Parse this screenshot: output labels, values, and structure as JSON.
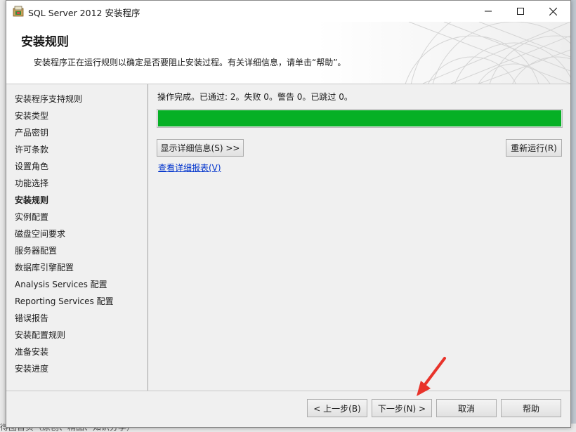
{
  "window": {
    "title": "SQL Server 2012 安装程序"
  },
  "header": {
    "title": "安装规则",
    "description": "安装程序正在运行规则以确定是否要阻止安装过程。有关详细信息，请单击“帮助”。"
  },
  "sidebar": {
    "items": [
      {
        "label": "安装程序支持规则",
        "active": false
      },
      {
        "label": "安装类型",
        "active": false
      },
      {
        "label": "产品密钥",
        "active": false
      },
      {
        "label": "许可条款",
        "active": false
      },
      {
        "label": "设置角色",
        "active": false
      },
      {
        "label": "功能选择",
        "active": false
      },
      {
        "label": "安装规则",
        "active": true
      },
      {
        "label": "实例配置",
        "active": false
      },
      {
        "label": "磁盘空间要求",
        "active": false
      },
      {
        "label": "服务器配置",
        "active": false
      },
      {
        "label": "数据库引擎配置",
        "active": false
      },
      {
        "label": "Analysis Services 配置",
        "active": false
      },
      {
        "label": "Reporting Services 配置",
        "active": false
      },
      {
        "label": "错误报告",
        "active": false
      },
      {
        "label": "安装配置规则",
        "active": false
      },
      {
        "label": "准备安装",
        "active": false
      },
      {
        "label": "安装进度",
        "active": false
      }
    ]
  },
  "main": {
    "status": "操作完成。已通过: 2。失败 0。警告 0。已跳过 0。",
    "progress_fraction": 1.0,
    "progress_color": "#06b025",
    "show_details_label": "显示详细信息(S) >>",
    "rerun_label": "重新运行(R)",
    "view_report_label": "查看详细报表(V)"
  },
  "footer": {
    "back_label": "< 上一步(B)",
    "next_label": "下一步(N) >",
    "cancel_label": "取消",
    "help_label": "帮助"
  },
  "background": {
    "bottom_text": "得图首页（原创、精品、知识分享）"
  },
  "icons": {
    "app": "sql-server-setup-icon",
    "minimize": "minimize-icon",
    "maximize": "maximize-icon",
    "close": "close-icon",
    "annotation": "red-arrow-icon"
  },
  "colors": {
    "annotation_arrow": "#e8332a",
    "link": "#0033cc"
  }
}
